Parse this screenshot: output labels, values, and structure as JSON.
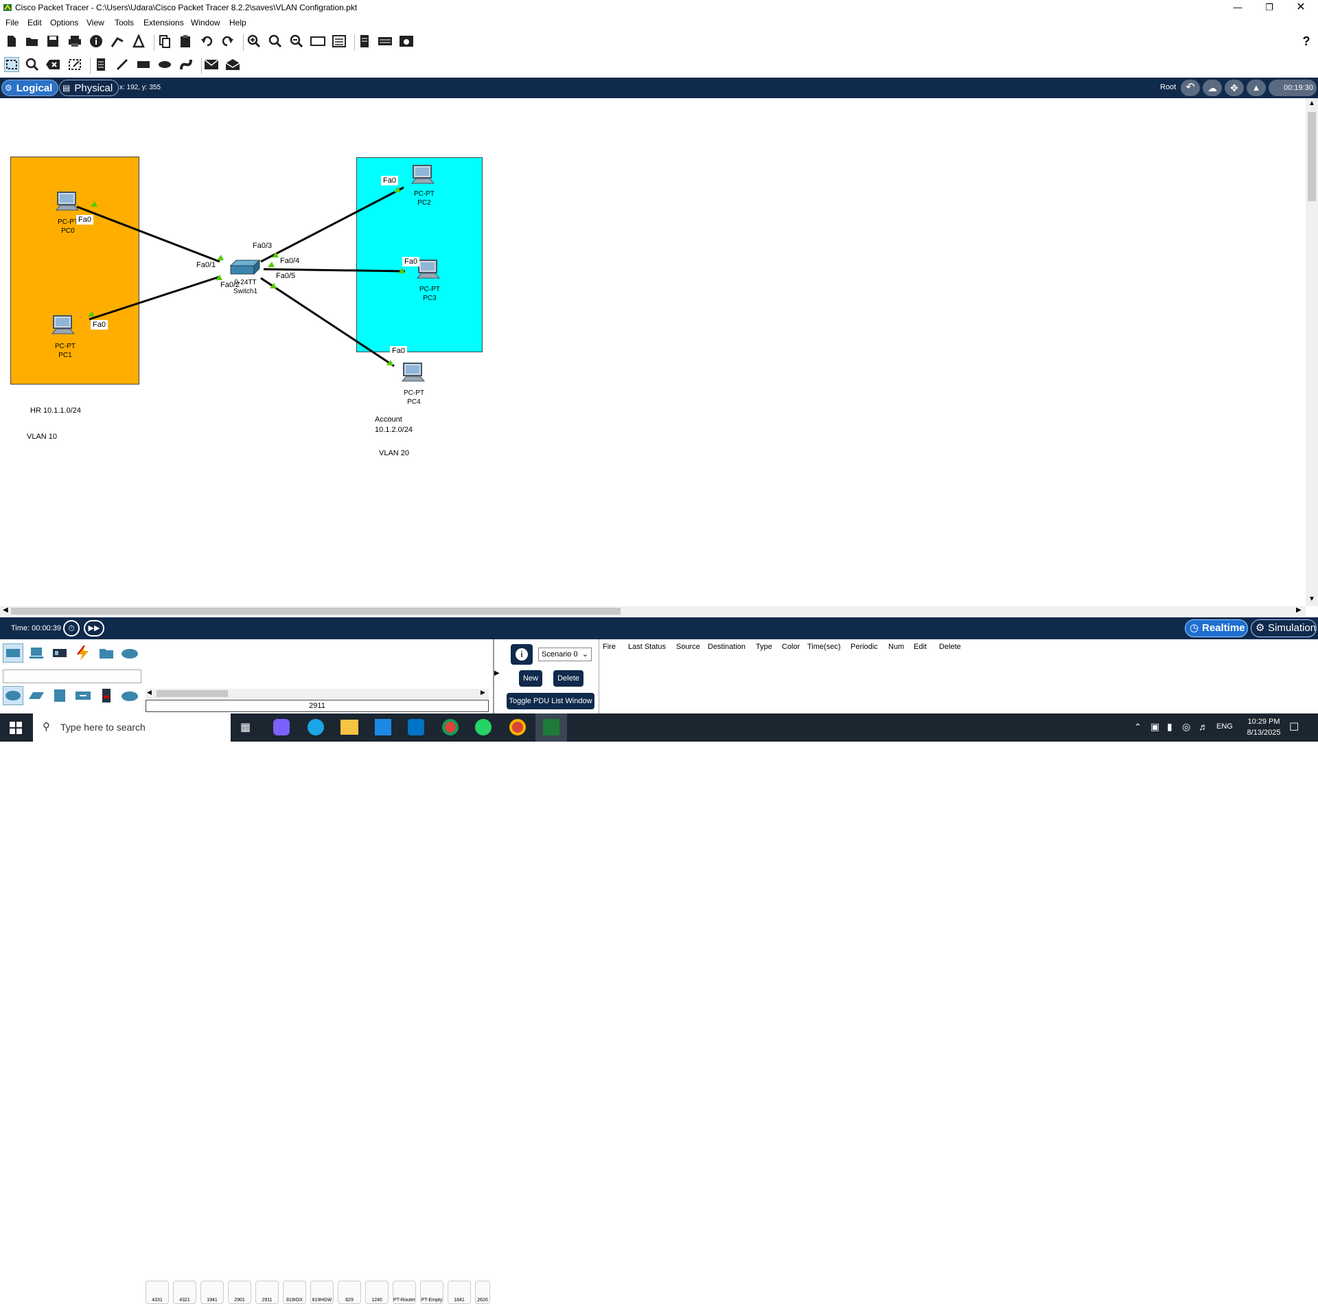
{
  "window": {
    "title": "Cisco Packet Tracer - C:\\Users\\Udara\\Cisco Packet Tracer 8.2.2\\saves\\VLAN Configration.pkt",
    "controls": [
      "minimize-icon",
      "restore-icon",
      "close-icon"
    ]
  },
  "menu": [
    "File",
    "Edit",
    "Options",
    "View",
    "Tools",
    "Extensions",
    "Window",
    "Help"
  ],
  "toolbar_icons": [
    "new-icon",
    "open-icon",
    "save-icon",
    "print-icon",
    "info-icon",
    "network-wizard-icon",
    "activity-wizard-icon",
    "copy-icon",
    "paste-icon",
    "undo-icon",
    "redo-icon",
    "zoom-in-icon",
    "zoom-reset-icon",
    "zoom-out-icon",
    "drawing-palette-icon",
    "custom-devices-icon",
    "cluster-icon",
    "viewport-icon",
    "pt-options-icon",
    "help-icon"
  ],
  "tool_icons": [
    "select-icon",
    "inspect-icon",
    "delete-icon",
    "resize-icon",
    "note-icon",
    "line-icon",
    "rectangle-icon",
    "ellipse-icon",
    "freeform-icon",
    "add-simple-pdu-icon",
    "add-complex-pdu-icon"
  ],
  "modebar": {
    "logical_label": "Logical",
    "physical_label": "Physical",
    "coords": "x: 192, y: 355",
    "root_label": "Root",
    "clock": "00:19:30"
  },
  "topology": {
    "zones": [
      {
        "name": "HR",
        "color": "#ffae00"
      },
      {
        "name": "Account",
        "color": "#00ffff"
      }
    ],
    "devices": {
      "pc0": {
        "model": "PC-PT",
        "name": "PC0"
      },
      "pc1": {
        "model": "PC-PT",
        "name": "PC1"
      },
      "pc2": {
        "model": "PC-PT",
        "name": "PC2"
      },
      "pc3": {
        "model": "PC-PT",
        "name": "PC3"
      },
      "pc4": {
        "model": "PC-PT",
        "name": "PC4"
      },
      "switch": {
        "model": "0-24TT",
        "name": "Switch1"
      }
    },
    "port_labels": {
      "pc0": "Fa0",
      "pc1": "Fa0",
      "pc2": "Fa0",
      "pc3": "Fa0",
      "pc4": "Fa0",
      "sw_fa01": "Fa0/1",
      "sw_fa02": "Fa0/2",
      "sw_fa03": "Fa0/3",
      "sw_fa04": "Fa0/4",
      "sw_fa05": "Fa0/5"
    },
    "notes": {
      "hr_subnet": "HR 10.1.1.0/24",
      "hr_vlan": "VLAN 10",
      "account_name": "Account",
      "account_subnet": "10.1.2.0/24",
      "account_vlan": "VLAN 20"
    },
    "link_color": "#000000",
    "link_up_color": "#5ac800"
  },
  "timebar": {
    "time": "Time: 00:00:39",
    "realtime_label": "Realtime",
    "simulation_label": "Simulation"
  },
  "device_models": [
    "4331",
    "4321",
    "1941",
    "2901",
    "2911",
    "819IOX",
    "819HGW",
    "829",
    "1240",
    "PT-Router",
    "PT-Empty",
    "1841",
    "2620"
  ],
  "selected_model": "2911",
  "scenario": {
    "selected": "Scenario 0",
    "new_label": "New",
    "delete_label": "Delete",
    "toggle_label": "Toggle PDU List Window"
  },
  "pdu_columns": [
    "Fire",
    "Last Status",
    "Source",
    "Destination",
    "Type",
    "Color",
    "Time(sec)",
    "Periodic",
    "Num",
    "Edit",
    "Delete"
  ],
  "taskbar": {
    "search_placeholder": "Type here to search",
    "language": "ENG",
    "time": "10:29 PM",
    "date": "8/13/2025"
  }
}
